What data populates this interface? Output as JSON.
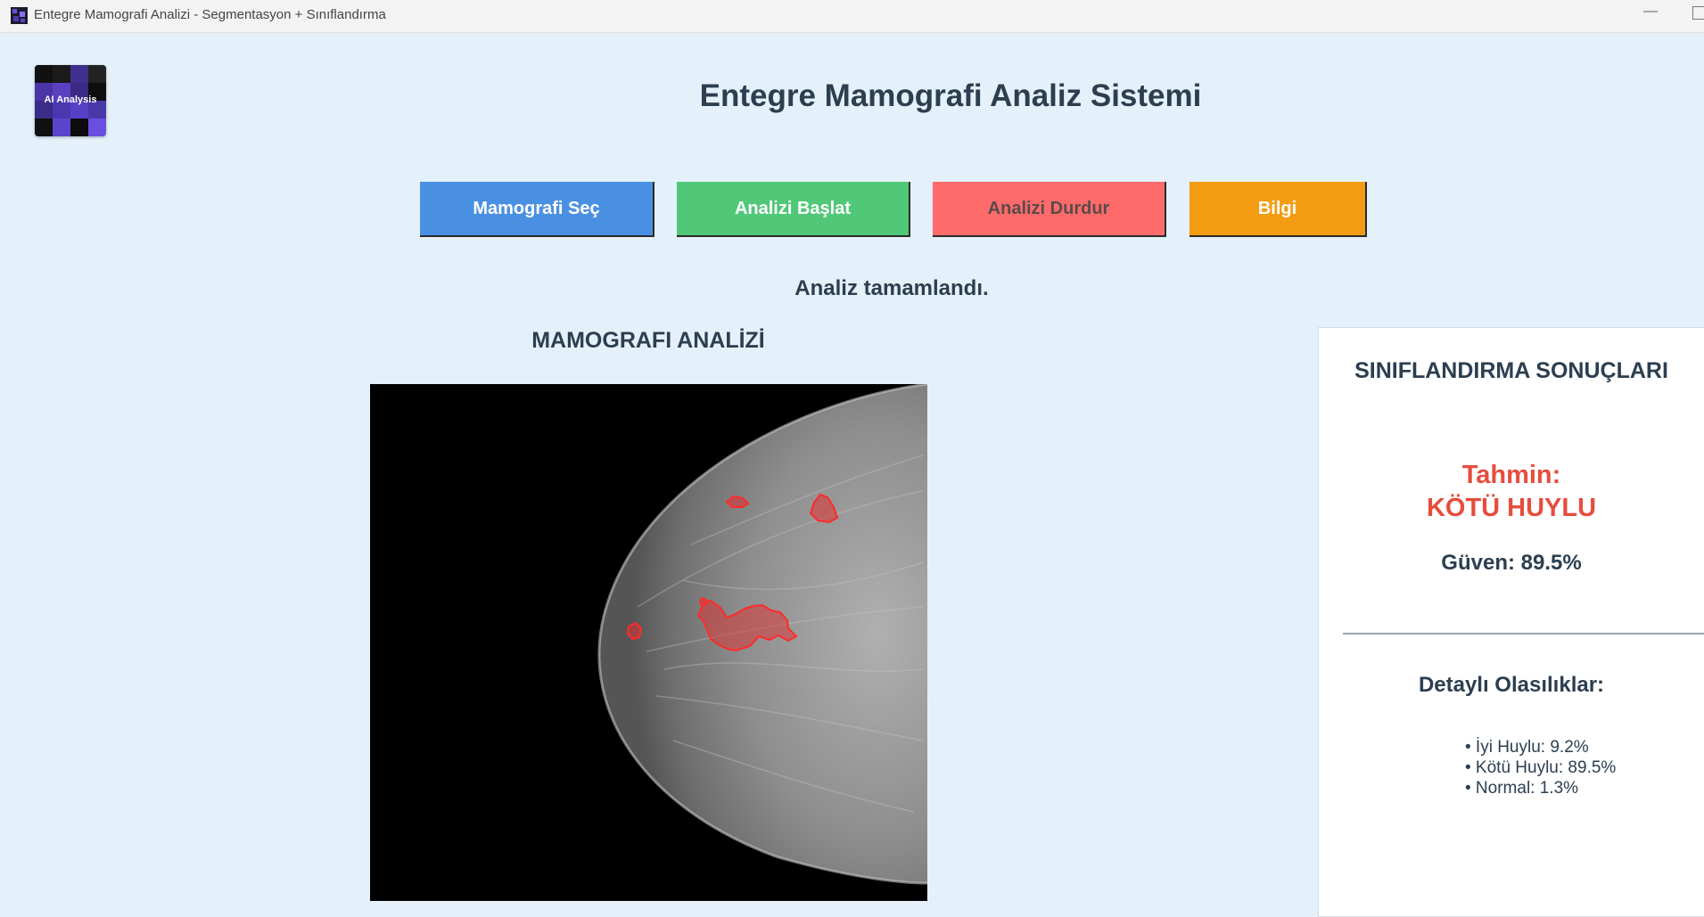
{
  "window": {
    "title": "Entegre Mamografi Analizi - Segmentasyon + Sınıflandırma",
    "minimize_glyph": "—"
  },
  "logo": {
    "label": "AI Analysis"
  },
  "header": {
    "title": "Entegre Mamografi Analiz Sistemi"
  },
  "toolbar": {
    "select_label": "Mamografi Seç",
    "start_label": "Analizi Başlat",
    "stop_label": "Analizi Durdur",
    "info_label": "Bilgi"
  },
  "status": {
    "text": "Analiz tamamlandı."
  },
  "viewer": {
    "title": "MAMOGRAFI ANALİZİ"
  },
  "results": {
    "title": "SINIFLANDIRMA SONUÇLARI",
    "prediction_label": "Tahmin:",
    "prediction_value": "KÖTÜ HUYLU",
    "confidence": "Güven: 89.5%",
    "details_title": "Detaylı Olasılıklar:",
    "probabilities": [
      "• İyi Huylu: 9.2%",
      "• Kötü Huylu: 89.5%",
      "• Normal: 1.3%"
    ]
  },
  "colors": {
    "background": "#e4f1fa",
    "select_button": "#4a90e2",
    "start_button": "#50c878",
    "stop_button": "#ff6b6b",
    "info_button": "#f39c12",
    "prediction": "#e74c3c",
    "text": "#2c3e50",
    "lesion": "#e03030"
  },
  "icons": {
    "app": "app-icon",
    "logo": "ai-logo-image",
    "image": "mammogram-image"
  }
}
